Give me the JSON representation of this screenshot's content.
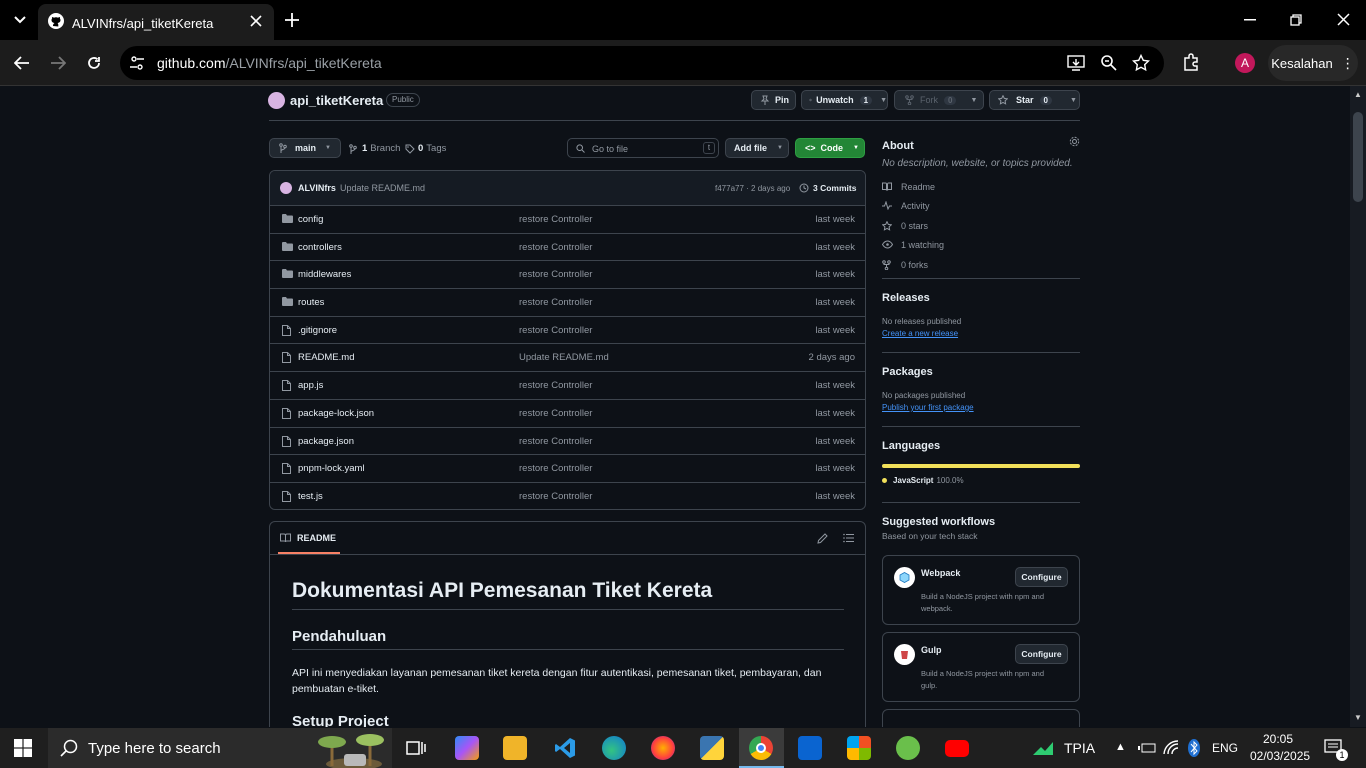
{
  "browser": {
    "tab_title": "ALVINfrs/api_tiketKereta",
    "url_host": "github.com",
    "url_path": "/ALVINfrs/api_tiketKereta",
    "profile_initial": "A",
    "error_button": "Kesalahan"
  },
  "repo": {
    "name": "api_tiketKereta",
    "visibility": "Public",
    "pin_label": "Pin",
    "unwatch_label": "Unwatch",
    "unwatch_count": "1",
    "fork_label": "Fork",
    "fork_count": "0",
    "star_label": "Star",
    "star_count": "0"
  },
  "toolbar": {
    "branch": "main",
    "branch_count": "1",
    "branch_label": "Branch",
    "tag_count": "0",
    "tag_label": "Tags",
    "goto_placeholder": "Go to file",
    "goto_key": "t",
    "add_file": "Add file",
    "code": "Code"
  },
  "commit": {
    "author": "ALVINfrs",
    "message": "Update README.md",
    "hash_time": "f477a77 · 2 days ago",
    "commits": "3 Commits"
  },
  "files": [
    {
      "name": "config",
      "type": "dir",
      "message": "restore Controller",
      "time": "last week"
    },
    {
      "name": "controllers",
      "type": "dir",
      "message": "restore Controller",
      "time": "last week"
    },
    {
      "name": "middlewares",
      "type": "dir",
      "message": "restore Controller",
      "time": "last week"
    },
    {
      "name": "routes",
      "type": "dir",
      "message": "restore Controller",
      "time": "last week"
    },
    {
      "name": ".gitignore",
      "type": "file",
      "message": "restore Controller",
      "time": "last week"
    },
    {
      "name": "README.md",
      "type": "file",
      "message": "Update README.md",
      "time": "2 days ago"
    },
    {
      "name": "app.js",
      "type": "file",
      "message": "restore Controller",
      "time": "last week"
    },
    {
      "name": "package-lock.json",
      "type": "file",
      "message": "restore Controller",
      "time": "last week"
    },
    {
      "name": "package.json",
      "type": "file",
      "message": "restore Controller",
      "time": "last week"
    },
    {
      "name": "pnpm-lock.yaml",
      "type": "file",
      "message": "restore Controller",
      "time": "last week"
    },
    {
      "name": "test.js",
      "type": "file",
      "message": "restore Controller",
      "time": "last week"
    }
  ],
  "readme": {
    "tab": "README",
    "h1": "Dokumentasi API Pemesanan Tiket Kereta",
    "h2a": "Pendahuluan",
    "para": "API ini menyediakan layanan pemesanan tiket kereta dengan fitur autentikasi, pemesanan tiket, pembayaran, dan pembuatan e-tiket.",
    "h2b": "Setup Project"
  },
  "about": {
    "title": "About",
    "description": "No description, website, or topics provided.",
    "items": [
      "Readme",
      "Activity",
      "0 stars",
      "1 watching",
      "0 forks"
    ]
  },
  "releases": {
    "title": "Releases",
    "none": "No releases published",
    "link": "Create a new release"
  },
  "packages": {
    "title": "Packages",
    "none": "No packages published",
    "link": "Publish your first package"
  },
  "languages": {
    "title": "Languages",
    "lang": "JavaScript",
    "percent": "100.0%",
    "fraction": 1.0,
    "color": "#f1e05a"
  },
  "workflows": {
    "title": "Suggested workflows",
    "subtitle": "Based on your tech stack",
    "cards": [
      {
        "name": "Webpack",
        "button": "Configure",
        "desc": "Build a NodeJS project with npm and webpack."
      },
      {
        "name": "Gulp",
        "button": "Configure",
        "desc": "Build a NodeJS project with npm and gulp."
      }
    ]
  },
  "taskbar": {
    "search_placeholder": "Type here to search",
    "tray_app": "TPIA",
    "lang": "ENG",
    "time": "20:05",
    "date": "02/03/2025",
    "notif_count": "1"
  }
}
